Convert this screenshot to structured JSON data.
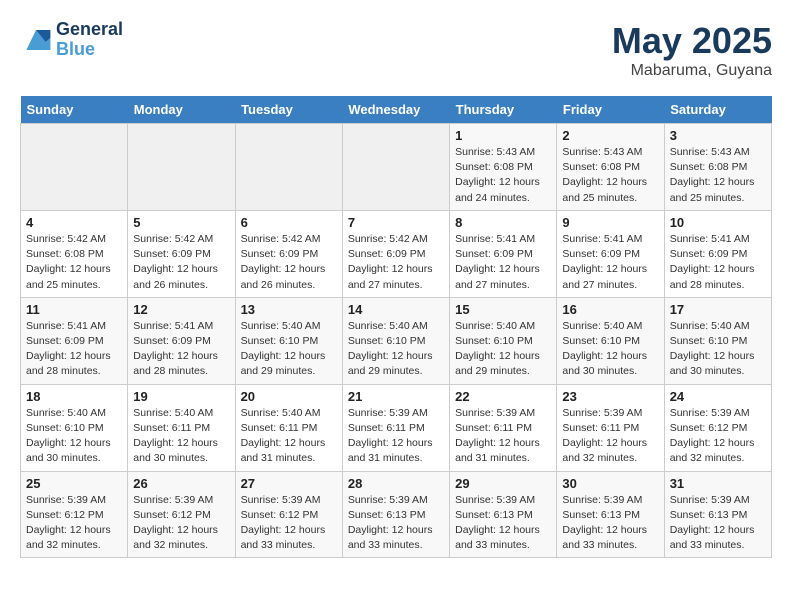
{
  "header": {
    "logo_line1": "General",
    "logo_line2": "Blue",
    "month_year": "May 2025",
    "location": "Mabaruma, Guyana"
  },
  "days_of_week": [
    "Sunday",
    "Monday",
    "Tuesday",
    "Wednesday",
    "Thursday",
    "Friday",
    "Saturday"
  ],
  "weeks": [
    [
      {
        "day": "",
        "info": ""
      },
      {
        "day": "",
        "info": ""
      },
      {
        "day": "",
        "info": ""
      },
      {
        "day": "",
        "info": ""
      },
      {
        "day": "1",
        "info": "Sunrise: 5:43 AM\nSunset: 6:08 PM\nDaylight: 12 hours\nand 24 minutes."
      },
      {
        "day": "2",
        "info": "Sunrise: 5:43 AM\nSunset: 6:08 PM\nDaylight: 12 hours\nand 25 minutes."
      },
      {
        "day": "3",
        "info": "Sunrise: 5:43 AM\nSunset: 6:08 PM\nDaylight: 12 hours\nand 25 minutes."
      }
    ],
    [
      {
        "day": "4",
        "info": "Sunrise: 5:42 AM\nSunset: 6:08 PM\nDaylight: 12 hours\nand 25 minutes."
      },
      {
        "day": "5",
        "info": "Sunrise: 5:42 AM\nSunset: 6:09 PM\nDaylight: 12 hours\nand 26 minutes."
      },
      {
        "day": "6",
        "info": "Sunrise: 5:42 AM\nSunset: 6:09 PM\nDaylight: 12 hours\nand 26 minutes."
      },
      {
        "day": "7",
        "info": "Sunrise: 5:42 AM\nSunset: 6:09 PM\nDaylight: 12 hours\nand 27 minutes."
      },
      {
        "day": "8",
        "info": "Sunrise: 5:41 AM\nSunset: 6:09 PM\nDaylight: 12 hours\nand 27 minutes."
      },
      {
        "day": "9",
        "info": "Sunrise: 5:41 AM\nSunset: 6:09 PM\nDaylight: 12 hours\nand 27 minutes."
      },
      {
        "day": "10",
        "info": "Sunrise: 5:41 AM\nSunset: 6:09 PM\nDaylight: 12 hours\nand 28 minutes."
      }
    ],
    [
      {
        "day": "11",
        "info": "Sunrise: 5:41 AM\nSunset: 6:09 PM\nDaylight: 12 hours\nand 28 minutes."
      },
      {
        "day": "12",
        "info": "Sunrise: 5:41 AM\nSunset: 6:09 PM\nDaylight: 12 hours\nand 28 minutes."
      },
      {
        "day": "13",
        "info": "Sunrise: 5:40 AM\nSunset: 6:10 PM\nDaylight: 12 hours\nand 29 minutes."
      },
      {
        "day": "14",
        "info": "Sunrise: 5:40 AM\nSunset: 6:10 PM\nDaylight: 12 hours\nand 29 minutes."
      },
      {
        "day": "15",
        "info": "Sunrise: 5:40 AM\nSunset: 6:10 PM\nDaylight: 12 hours\nand 29 minutes."
      },
      {
        "day": "16",
        "info": "Sunrise: 5:40 AM\nSunset: 6:10 PM\nDaylight: 12 hours\nand 30 minutes."
      },
      {
        "day": "17",
        "info": "Sunrise: 5:40 AM\nSunset: 6:10 PM\nDaylight: 12 hours\nand 30 minutes."
      }
    ],
    [
      {
        "day": "18",
        "info": "Sunrise: 5:40 AM\nSunset: 6:10 PM\nDaylight: 12 hours\nand 30 minutes."
      },
      {
        "day": "19",
        "info": "Sunrise: 5:40 AM\nSunset: 6:11 PM\nDaylight: 12 hours\nand 30 minutes."
      },
      {
        "day": "20",
        "info": "Sunrise: 5:40 AM\nSunset: 6:11 PM\nDaylight: 12 hours\nand 31 minutes."
      },
      {
        "day": "21",
        "info": "Sunrise: 5:39 AM\nSunset: 6:11 PM\nDaylight: 12 hours\nand 31 minutes."
      },
      {
        "day": "22",
        "info": "Sunrise: 5:39 AM\nSunset: 6:11 PM\nDaylight: 12 hours\nand 31 minutes."
      },
      {
        "day": "23",
        "info": "Sunrise: 5:39 AM\nSunset: 6:11 PM\nDaylight: 12 hours\nand 32 minutes."
      },
      {
        "day": "24",
        "info": "Sunrise: 5:39 AM\nSunset: 6:12 PM\nDaylight: 12 hours\nand 32 minutes."
      }
    ],
    [
      {
        "day": "25",
        "info": "Sunrise: 5:39 AM\nSunset: 6:12 PM\nDaylight: 12 hours\nand 32 minutes."
      },
      {
        "day": "26",
        "info": "Sunrise: 5:39 AM\nSunset: 6:12 PM\nDaylight: 12 hours\nand 32 minutes."
      },
      {
        "day": "27",
        "info": "Sunrise: 5:39 AM\nSunset: 6:12 PM\nDaylight: 12 hours\nand 33 minutes."
      },
      {
        "day": "28",
        "info": "Sunrise: 5:39 AM\nSunset: 6:13 PM\nDaylight: 12 hours\nand 33 minutes."
      },
      {
        "day": "29",
        "info": "Sunrise: 5:39 AM\nSunset: 6:13 PM\nDaylight: 12 hours\nand 33 minutes."
      },
      {
        "day": "30",
        "info": "Sunrise: 5:39 AM\nSunset: 6:13 PM\nDaylight: 12 hours\nand 33 minutes."
      },
      {
        "day": "31",
        "info": "Sunrise: 5:39 AM\nSunset: 6:13 PM\nDaylight: 12 hours\nand 33 minutes."
      }
    ]
  ]
}
